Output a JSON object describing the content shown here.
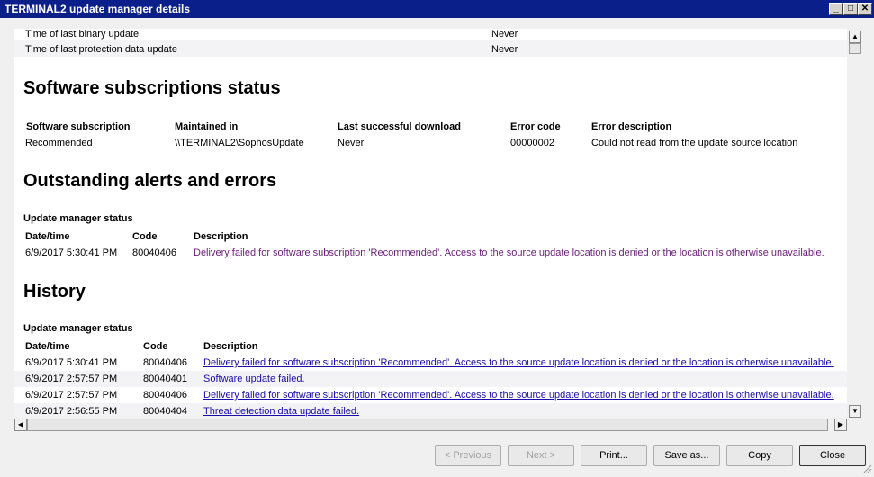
{
  "window": {
    "title": "TERMINAL2 update manager details"
  },
  "top_rows": [
    {
      "label": "Time of last binary update",
      "value": "Never"
    },
    {
      "label": "Time of last protection data update",
      "value": "Never"
    }
  ],
  "subscriptions": {
    "heading": "Software subscriptions status",
    "columns": [
      "Software subscription",
      "Maintained in",
      "Last successful download",
      "Error code",
      "Error description"
    ],
    "rows": [
      [
        "Recommended",
        "\\\\TERMINAL2\\SophosUpdate",
        "Never",
        "00000002",
        "Could not read from the update source location"
      ]
    ]
  },
  "alerts": {
    "heading": "Outstanding alerts and errors",
    "subheading": "Update manager status",
    "columns": [
      "Date/time",
      "Code",
      "Description"
    ],
    "rows": [
      [
        "6/9/2017 5:30:41 PM",
        "80040406",
        "Delivery failed for software subscription 'Recommended'. Access to the source update location is denied or the location is otherwise unavailable."
      ]
    ]
  },
  "history": {
    "heading": "History",
    "subheading": "Update manager status",
    "columns": [
      "Date/time",
      "Code",
      "Description"
    ],
    "rows": [
      [
        "6/9/2017 5:30:41 PM",
        "80040406",
        "Delivery failed for software subscription 'Recommended'. Access to the source update location is denied or the location is otherwise unavailable."
      ],
      [
        "6/9/2017 2:57:57 PM",
        "80040401",
        "Software update failed."
      ],
      [
        "6/9/2017 2:57:57 PM",
        "80040406",
        "Delivery failed for software subscription 'Recommended'. Access to the source update location is denied or the location is otherwise unavailable."
      ],
      [
        "6/9/2017 2:56:55 PM",
        "80040404",
        "Threat detection data update failed."
      ]
    ]
  },
  "buttons": {
    "previous": "< Previous",
    "next": "Next >",
    "print": "Print...",
    "save_as": "Save as...",
    "copy": "Copy",
    "close": "Close"
  },
  "window_controls": {
    "minimize": "_",
    "maximize": "□",
    "close": "✕"
  },
  "scroll_arrows": {
    "up": "▲",
    "down": "▼",
    "left": "◀",
    "right": "▶"
  },
  "colors": {
    "titlebar": "#0b1f8a",
    "link": "#1a0dab",
    "visited_link": "#6a1b7a"
  }
}
